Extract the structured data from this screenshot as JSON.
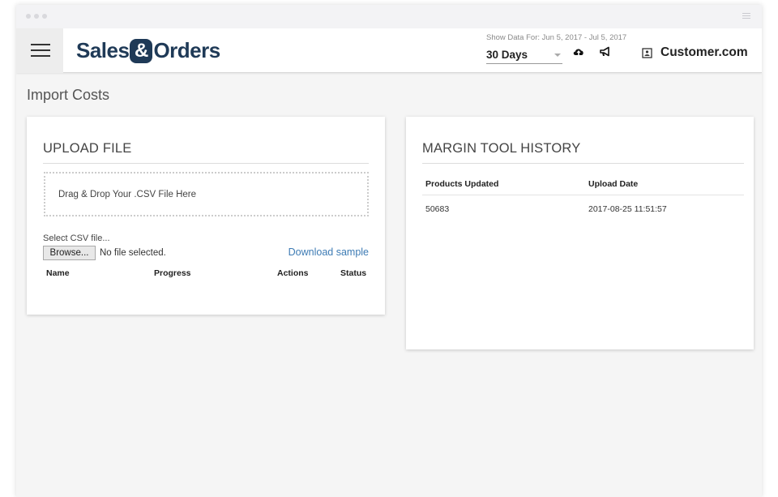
{
  "header": {
    "brand_left": "Sales",
    "brand_amp": "&",
    "brand_right": "Orders",
    "show_data_label": "Show Data For: Jun 5, 2017 - Jul 5, 2017",
    "range_value": "30 Days",
    "customer": "Customer.com",
    "icons": [
      "menu-icon",
      "cloud-upload-icon",
      "megaphone-icon",
      "contact-card-icon"
    ]
  },
  "page": {
    "title": "Import Costs"
  },
  "upload": {
    "title": "UPLOAD FILE",
    "dropzone_text": "Drag & Drop Your .CSV File Here",
    "select_label": "Select CSV file...",
    "browse_label": "Browse...",
    "no_file_text": "No file selected.",
    "download_link": "Download sample",
    "columns": [
      "Name",
      "Progress",
      "Actions",
      "Status"
    ]
  },
  "history": {
    "title": "MARGIN TOOL HISTORY",
    "columns": [
      "Products Updated",
      "Upload Date"
    ],
    "rows": [
      [
        "50683",
        "2017-08-25 11:51:57"
      ]
    ]
  },
  "colors": {
    "brand": "#1f3a57",
    "link": "#3d7bb4",
    "background": "#f5f5f5"
  }
}
